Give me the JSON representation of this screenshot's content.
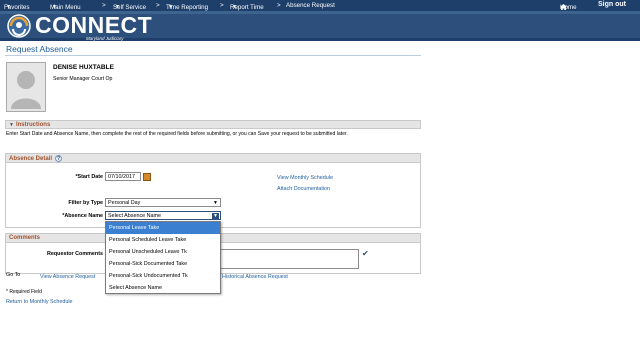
{
  "nav": {
    "favorites": "Favorites",
    "main_menu": "Main Menu",
    "sep": ">",
    "self_service": "Self Service",
    "time_reporting": "Time Reporting",
    "report_time": "Report Time",
    "absence_request": "Absence Request",
    "home": "Home",
    "sign_out": "Sign out"
  },
  "logo": {
    "text": "CONNECT",
    "sub": "Maryland Judiciary"
  },
  "page_title": "Request Absence",
  "employee": {
    "name": "DENISE HUXTABLE",
    "title": "Senior Manager Court Op"
  },
  "instructions": {
    "header": "Instructions",
    "text": "Enter Start Date and Absence Name, then complete the rest of the required fields before submitting, or you can Save your request to be submitted later."
  },
  "absence_detail": {
    "header": "Absence Detail",
    "help": "?",
    "start_date_label": "*Start Date",
    "start_date_value": "07/10/2017",
    "filter_label": "Filter by Type",
    "filter_value": "Personal Day",
    "absence_name_label": "*Absence Name",
    "absence_name_value": "Select Absence Name",
    "view_monthly": "View Monthly Schedule",
    "attach_doc": "Attach Documentation"
  },
  "dropdown": {
    "options": [
      "Personal Leave Take",
      "Personal Scheduled Leave Take",
      "Personal Unscheduled Leave Tk",
      "Personal-Sick Documented Take",
      "Personal-Sick Undocumented Tk",
      "Select Absence Name"
    ],
    "selected_index": 0
  },
  "comments": {
    "header": "Comments",
    "requestor_label": "Requestor Comments"
  },
  "goto": {
    "label": "Go To",
    "view_absence": "View Absence Request",
    "historical": "Historical Absence Request"
  },
  "footer": {
    "required": "* Required Field",
    "return_link": "Return to Monthly Schedule"
  },
  "colors": {
    "nav_bg": "#1d3f6a",
    "banner_bg": "#2c4f7c",
    "link": "#1f5e9d",
    "section_label": "#a0522d",
    "dropdown_highlight": "#3a7fd0"
  }
}
